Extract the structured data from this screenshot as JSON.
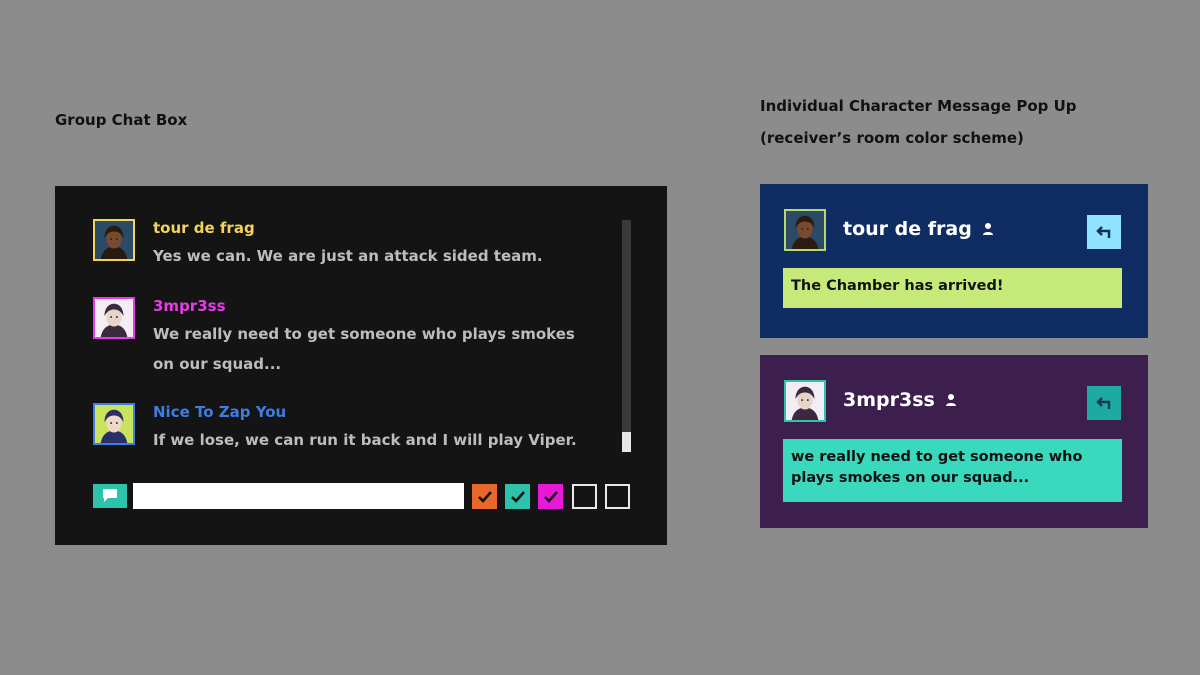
{
  "headings": {
    "group_chat": "Group Chat Box",
    "popup_line1": "Individual Character Message Pop Up",
    "popup_line2": "(receiver’s room color scheme)"
  },
  "chat": {
    "messages": [
      {
        "name": "tour de frag",
        "name_color": "#f2d35c",
        "avatar_border": "#f2d35c",
        "avatar_bg": "#2a4a66",
        "text": "Yes we can. We are just an attack sided team."
      },
      {
        "name": "3mpr3ss",
        "name_color": "#e63ce6",
        "avatar_border": "#e63ce6",
        "avatar_bg": "#ffffff",
        "text": "We really need to get someone who plays smokes on our squad..."
      },
      {
        "name": "Nice To Zap You",
        "name_color": "#3f7de0",
        "avatar_border": "#3f7de0",
        "avatar_bg": "#c9e35c",
        "text": "If we lose, we can run it back and I will play Viper."
      }
    ],
    "chat_icon": "speech-bubble-icon",
    "input_value": "",
    "input_placeholder": "",
    "filters": [
      {
        "color": "#e8672a",
        "checked": true
      },
      {
        "color": "#2cc3aa",
        "checked": true
      },
      {
        "color": "#e619d6",
        "checked": true
      },
      {
        "color": "",
        "checked": false
      },
      {
        "color": "",
        "checked": false
      }
    ]
  },
  "popups": [
    {
      "name": "tour de frag",
      "bg": "#0f2d63",
      "avatar_border": "#b7d96a",
      "reply_bg": "#8fe3ff",
      "msg_bg": "#c5ea7a",
      "message": "The Chamber has arrived!",
      "icons": [
        "person-icon",
        "reply-arrow-icon"
      ]
    },
    {
      "name": "3mpr3ss",
      "bg": "#3c1f4d",
      "avatar_border": "#2cc3aa",
      "reply_bg": "#1fa9a3",
      "msg_bg": "#3ad8bd",
      "message": "we really need to get someone who plays smokes on our squad...",
      "icons": [
        "person-icon",
        "reply-arrow-icon"
      ]
    }
  ]
}
